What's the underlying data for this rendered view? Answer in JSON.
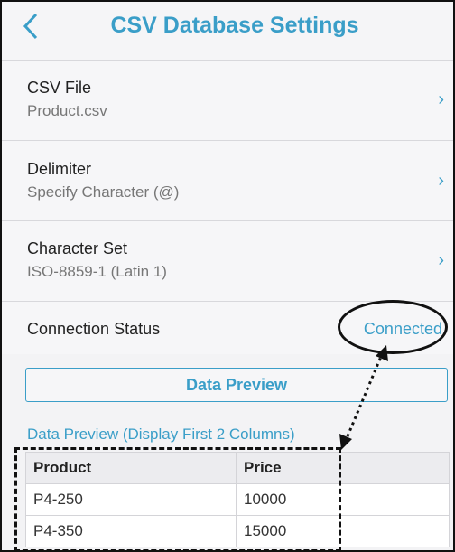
{
  "header": {
    "back_icon": "chevron-left-icon",
    "title": "CSV Database Settings"
  },
  "settings": {
    "csv_file": {
      "label": "CSV File",
      "value": "Product.csv"
    },
    "delimiter": {
      "label": "Delimiter",
      "value": "Specify Character (@)"
    },
    "character_set": {
      "label": "Character Set",
      "value": "ISO-8859-1 (Latin 1)"
    },
    "connection_status": {
      "label": "Connection Status",
      "value": "Connected"
    }
  },
  "chevron_glyph": "›",
  "preview": {
    "button_label": "Data Preview",
    "caption": "Data Preview (Display First 2 Columns)",
    "columns": [
      "Product",
      "Price"
    ],
    "rows": [
      [
        "P4-250",
        "10000"
      ],
      [
        "P4-350",
        "15000"
      ]
    ]
  },
  "colors": {
    "accent": "#3a9ec8",
    "background": "#f3f3f5",
    "annotation": "#111111"
  }
}
